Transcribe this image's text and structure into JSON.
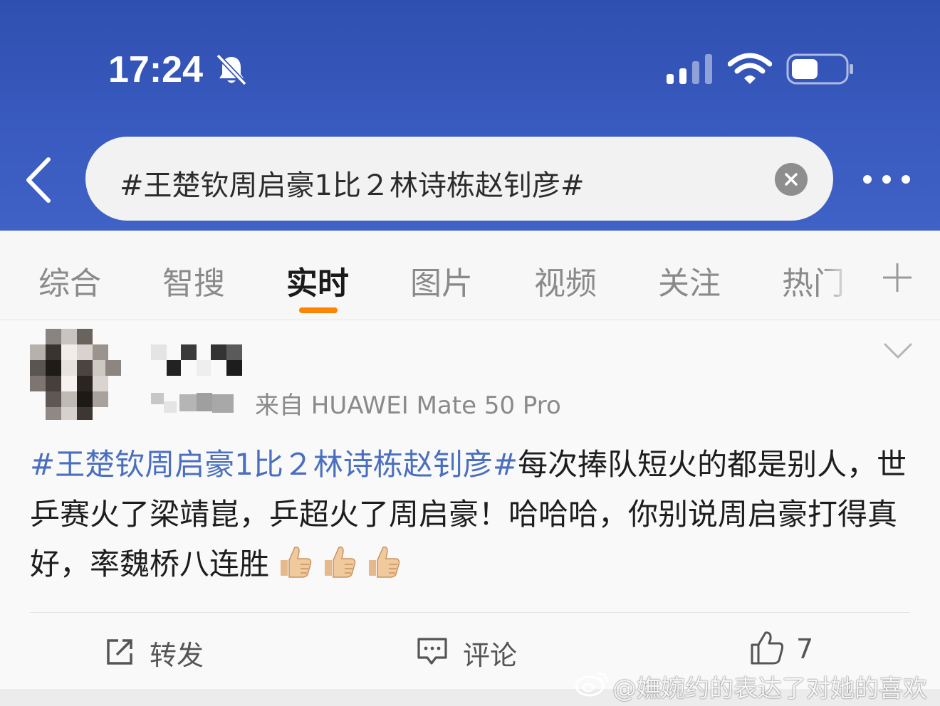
{
  "status_bar": {
    "time": "17:24",
    "icons": [
      "bell-muted-icon",
      "signal-icon",
      "wifi-icon",
      "battery-icon"
    ]
  },
  "search": {
    "query": "#王楚钦周启豪1比２林诗栋赵钊彦#",
    "back_icon": "chevron-left-icon",
    "clear_icon": "clear-icon",
    "more_icon": "more-icon"
  },
  "tabs": [
    {
      "label": "综合",
      "active": false
    },
    {
      "label": "智搜",
      "active": false
    },
    {
      "label": "实时",
      "active": true
    },
    {
      "label": "图片",
      "active": false
    },
    {
      "label": "视频",
      "active": false
    },
    {
      "label": "关注",
      "active": false
    },
    {
      "label": "热门",
      "active": false
    }
  ],
  "colors": {
    "header": "#3a5bc0",
    "accent": "#ff8200",
    "hashtag": "#4a6fbf"
  },
  "post": {
    "source": "来自 HUAWEI Mate 50 Pro",
    "hashtag": "#王楚钦周启豪1比２林诗栋赵钊彦#",
    "body": "每次捧队短火的都是别人，世乒赛火了梁靖崑，乒超火了周启豪！哈哈哈，你别说周启豪打得真好，率魏桥八连胜",
    "emojis": [
      "thumbs-up-icon",
      "thumbs-up-icon",
      "thumbs-up-icon"
    ]
  },
  "actions": {
    "repost_label": "转发",
    "comment_label": "评论",
    "like_count": "7"
  },
  "watermark": {
    "text": "@嫵婉约的表达了对她的喜欢"
  }
}
